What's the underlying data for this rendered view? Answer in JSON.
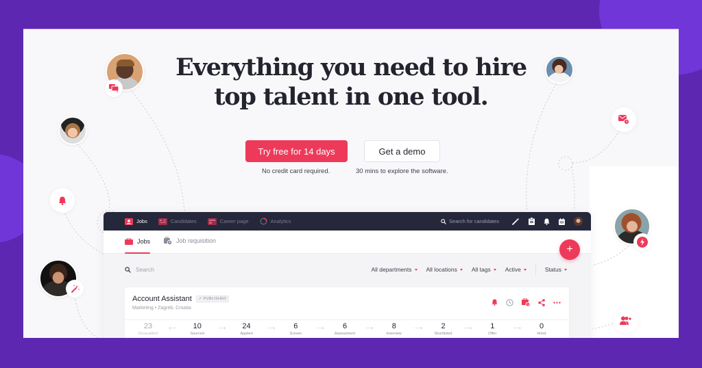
{
  "hero": {
    "headline_line1": "Everything you need to hire",
    "headline_line2": "top talent in one tool.",
    "primary_cta": "Try free for 14 days",
    "primary_note": "No credit card required.",
    "secondary_cta": "Get a demo",
    "secondary_note": "30 mins to explore the software."
  },
  "colors": {
    "accent": "#ee3a5a",
    "background": "#5e27b2",
    "nav_dark": "#25273a",
    "heading": "#23242e"
  },
  "floating_icons": [
    "chat-icon",
    "notification-bell-icon",
    "magic-wand-icon",
    "scheduled-email-icon",
    "lightning-icon",
    "add-user-icon"
  ],
  "app": {
    "topnav": [
      {
        "label": "Jobs",
        "icon": "jobs-icon",
        "active": true
      },
      {
        "label": "Candidates",
        "icon": "candidates-icon",
        "active": false
      },
      {
        "label": "Career page",
        "icon": "career-page-icon",
        "active": false
      },
      {
        "label": "Analytics",
        "icon": "analytics-icon",
        "active": false
      }
    ],
    "search_placeholder": "Search for candidates",
    "subtabs": [
      {
        "label": "Jobs",
        "active": true
      },
      {
        "label": "Job requisition",
        "active": false
      }
    ],
    "fab_label": "+",
    "filter_search_placeholder": "Search",
    "filters": [
      "All departments",
      "All locations",
      "All tags",
      "Active"
    ],
    "status_filter": "Status",
    "job": {
      "title": "Account Assistant",
      "status": "PUBLISHED",
      "status_check": "✓",
      "meta": "Marketing • Zagreb, Croatia",
      "pipeline": [
        {
          "count": "23",
          "label": "Disqualified"
        },
        {
          "count": "10",
          "label": "Sourced"
        },
        {
          "count": "24",
          "label": "Applied"
        },
        {
          "count": "6",
          "label": "Screen"
        },
        {
          "count": "6",
          "label": "Assessment"
        },
        {
          "count": "8",
          "label": "Interview"
        },
        {
          "count": "2",
          "label": "Shortlisted"
        },
        {
          "count": "1",
          "label": "Offer"
        },
        {
          "count": "0",
          "label": "Hired"
        }
      ]
    }
  }
}
